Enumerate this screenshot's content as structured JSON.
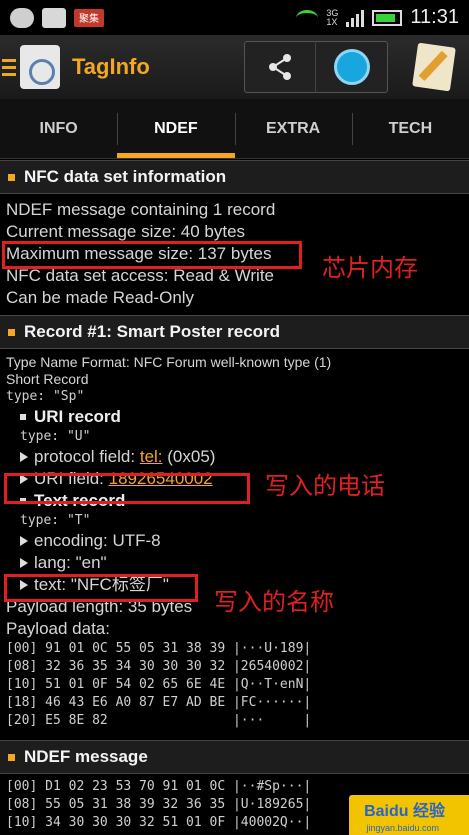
{
  "status_bar": {
    "badge_text": "聚集",
    "net_tags": [
      "3G",
      "1X"
    ],
    "time": "11:31"
  },
  "action_bar": {
    "title": "TagInfo"
  },
  "tabs": [
    {
      "label": "INFO",
      "active": false
    },
    {
      "label": "NDEF",
      "active": true
    },
    {
      "label": "EXTRA",
      "active": false
    },
    {
      "label": "TECH",
      "active": false
    }
  ],
  "nfc_info": {
    "header": "NFC data set information",
    "lines": [
      "NDEF message containing 1 record",
      "Current message size: 40 bytes",
      "Maximum message size: 137 bytes",
      "NFC data set access: Read & Write",
      "Can be made Read-Only"
    ]
  },
  "record": {
    "header": "Record #1: Smart Poster record",
    "tnf": "Type Name Format: NFC Forum well-known type (1)",
    "short_record": "Short Record",
    "type_line": "type: \"Sp\"",
    "uri_header": "URI record",
    "uri_type": "type: \"U\"",
    "protocol_prefix": "protocol field: ",
    "protocol_link": "tel:",
    "protocol_suffix": " (0x05)",
    "uri_field_prefix": "URI field: ",
    "uri_field_link": "18926540002",
    "text_header": "Text record",
    "text_type": "type: \"T\"",
    "encoding": "encoding: UTF-8",
    "lang": "lang: \"en\"",
    "text": "text: \"NFC标签厂\"",
    "payload_length": "Payload length: 35 bytes",
    "payload_data_label": "Payload data:",
    "payload_rows": [
      "[00] 91 01 0C 55 05 31 38 39 |···U·189|",
      "[08] 32 36 35 34 30 30 30 32 |26540002|",
      "[10] 51 01 0F 54 02 65 6E 4E |Q··T·enN|",
      "[18] 46 43 E6 A0 87 E7 AD BE |FC······|",
      "[20] E5 8E 82                |···     |"
    ]
  },
  "ndef_message": {
    "header": "NDEF message",
    "rows": [
      "[00] D1 02 23 53 70 91 01 0C |··#Sp···|",
      "[08] 55 05 31 38 39 32 36 35 |U·189265|",
      "[10] 34 30 30 30 32 51 01 0F |40002Q··|"
    ]
  },
  "annotations": {
    "memory": "芯片内存",
    "phone": "写入的电话",
    "name": "写入的名称"
  },
  "watermark": {
    "text": "Baidu 经验",
    "sub": "jingyan.baidu.com"
  }
}
